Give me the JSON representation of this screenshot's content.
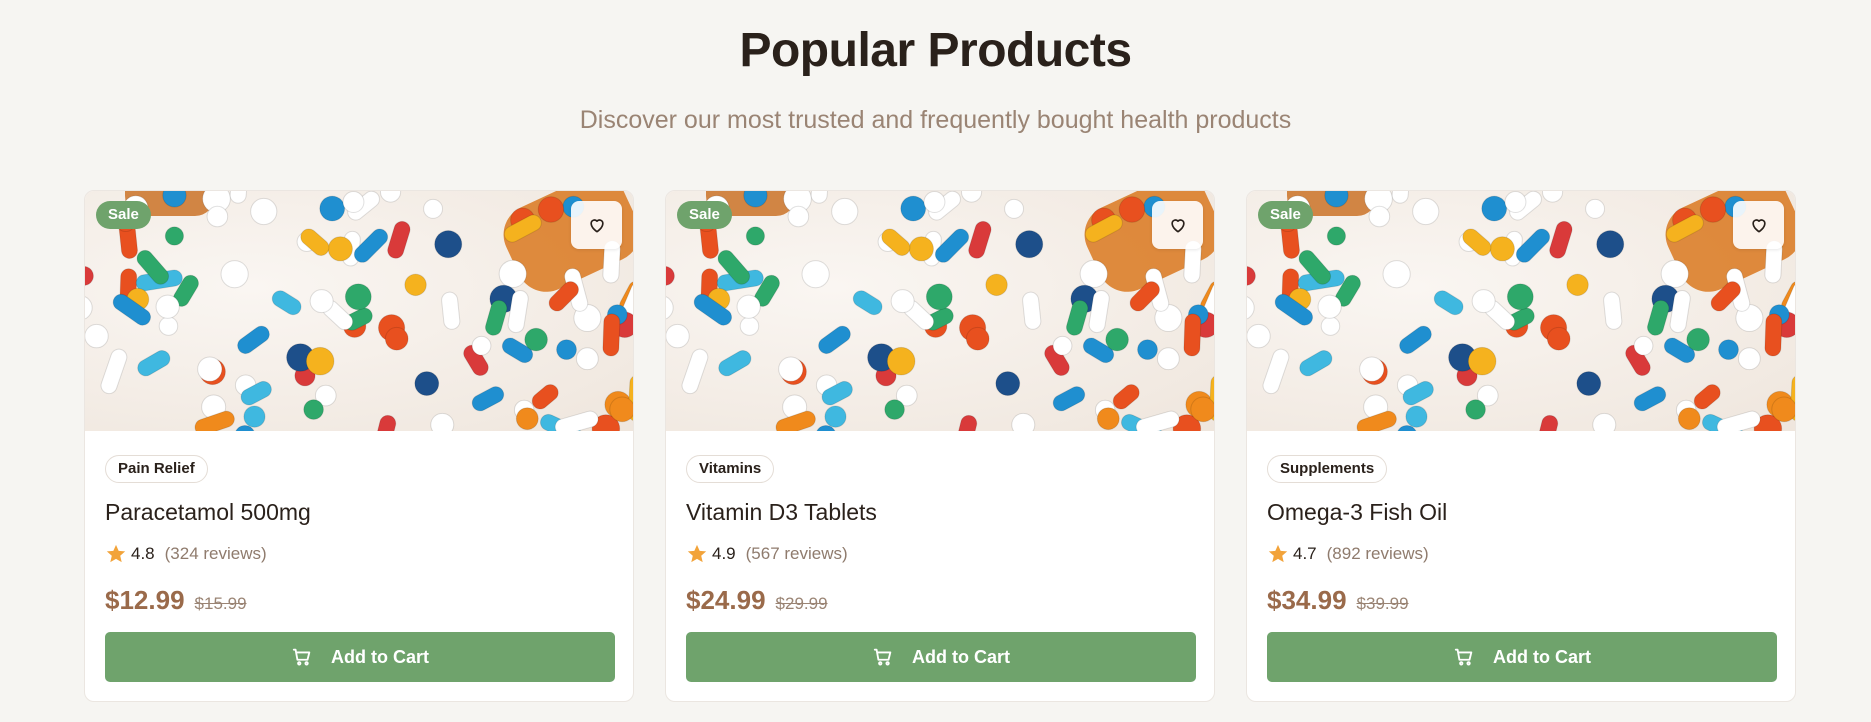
{
  "header": {
    "title": "Popular Products",
    "subtitle": "Discover our most trusted and frequently bought health products"
  },
  "products": [
    {
      "badge": "Sale",
      "category": "Pain Relief",
      "name": "Paracetamol 500mg",
      "rating": "4.8",
      "reviews": "(324 reviews)",
      "price": "$12.99",
      "old_price": "$15.99",
      "cart_label": "Add to Cart",
      "wishlist_icon": "heart-icon",
      "cart_icon": "cart-icon",
      "image": "colorful-pills-image"
    },
    {
      "badge": "Sale",
      "category": "Vitamins",
      "name": "Vitamin D3 Tablets",
      "rating": "4.9",
      "reviews": "(567 reviews)",
      "price": "$24.99",
      "old_price": "$29.99",
      "cart_label": "Add to Cart",
      "wishlist_icon": "heart-icon",
      "cart_icon": "cart-icon",
      "image": "colorful-pills-image"
    },
    {
      "badge": "Sale",
      "category": "Supplements",
      "name": "Omega-3 Fish Oil",
      "rating": "4.7",
      "reviews": "(892 reviews)",
      "price": "$34.99",
      "old_price": "$39.99",
      "cart_label": "Add to Cart",
      "wishlist_icon": "heart-icon",
      "cart_icon": "cart-icon",
      "image": "colorful-pills-image"
    }
  ],
  "colors": {
    "background": "#f6f5f2",
    "accent_green": "#6fa36c",
    "price_brown": "#9a6a4a",
    "muted_text": "#9a8474",
    "star": "#f2a33a"
  }
}
